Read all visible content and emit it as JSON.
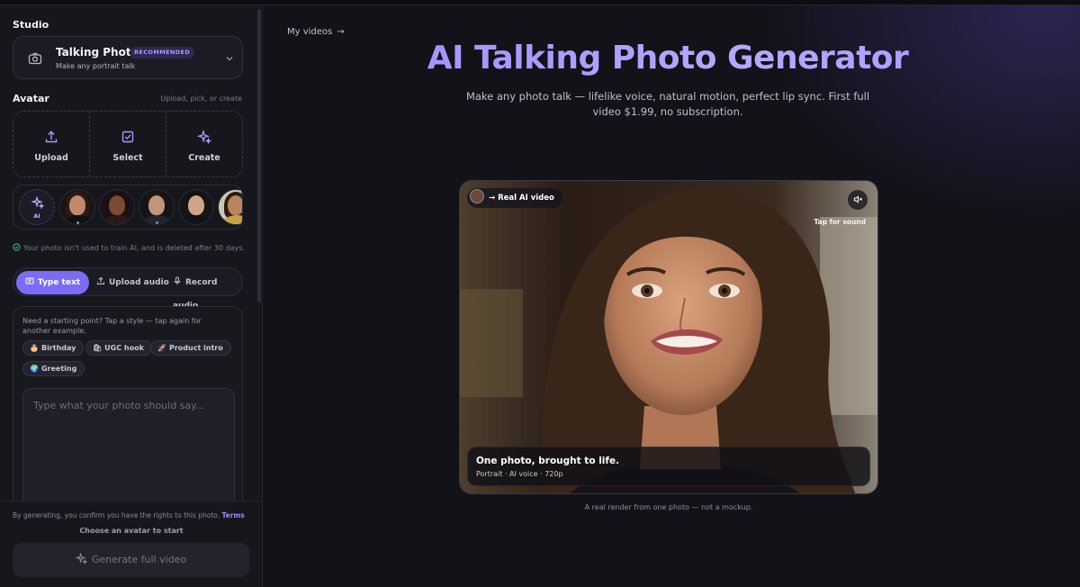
{
  "sidebar": {
    "studio_label": "Studio",
    "mode": {
      "title": "Talking Photo",
      "badge": "RECOMMENDED",
      "subtitle": "Make any portrait talk"
    },
    "avatar_label": "Avatar",
    "avatar_hint": "Upload, pick, or create",
    "actions": [
      {
        "label": "Upload",
        "icon": "upload-icon"
      },
      {
        "label": "Select",
        "icon": "checkbox-icon"
      },
      {
        "label": "Create",
        "icon": "sparkle-icon"
      }
    ],
    "ai_tile_label": "AI",
    "privacy_note": "Your photo isn't used to train AI, and is deleted after 30 days.",
    "tabs": [
      {
        "label": "Type text",
        "icon": "text-icon",
        "active": true
      },
      {
        "label": "Upload audio",
        "icon": "upload-icon",
        "active": false
      },
      {
        "label": "Record audio",
        "icon": "mic-icon",
        "active": false
      }
    ],
    "starter_text": "Need a starting point? Tap a style — tap again for another example.",
    "chips": [
      {
        "emoji": "🎂",
        "label": "Birthday"
      },
      {
        "emoji": "🛍",
        "label": "UGC hook"
      },
      {
        "emoji": "🚀",
        "label": "Product intro"
      },
      {
        "emoji": "🌍",
        "label": "Greeting"
      }
    ],
    "textarea_placeholder": "Type what your photo should say...",
    "footer": {
      "rights_text": "By generating, you confirm you have the rights to this photo.",
      "terms_link": "Terms",
      "choose_hint": "Choose an avatar to start",
      "generate_label": "Generate full video"
    }
  },
  "main": {
    "my_videos_link": "My videos",
    "hero_title": "AI Talking Photo Generator",
    "hero_subtitle": "Make any photo talk — lifelike voice, natural motion, perfect lip sync. First full video $1.99, no subscription.",
    "video": {
      "pill_label": "Real AI video",
      "tap_for_sound": "Tap for sound",
      "caption_title": "One photo, brought to life.",
      "caption_sub": "Portrait · AI voice · 720p"
    },
    "render_note": "A real render from one photo — not a mockup."
  },
  "colors": {
    "accent": "#7c6cf5",
    "title_gradient": "#a99bff",
    "background": "#121219",
    "sidebar": "#16161d"
  }
}
